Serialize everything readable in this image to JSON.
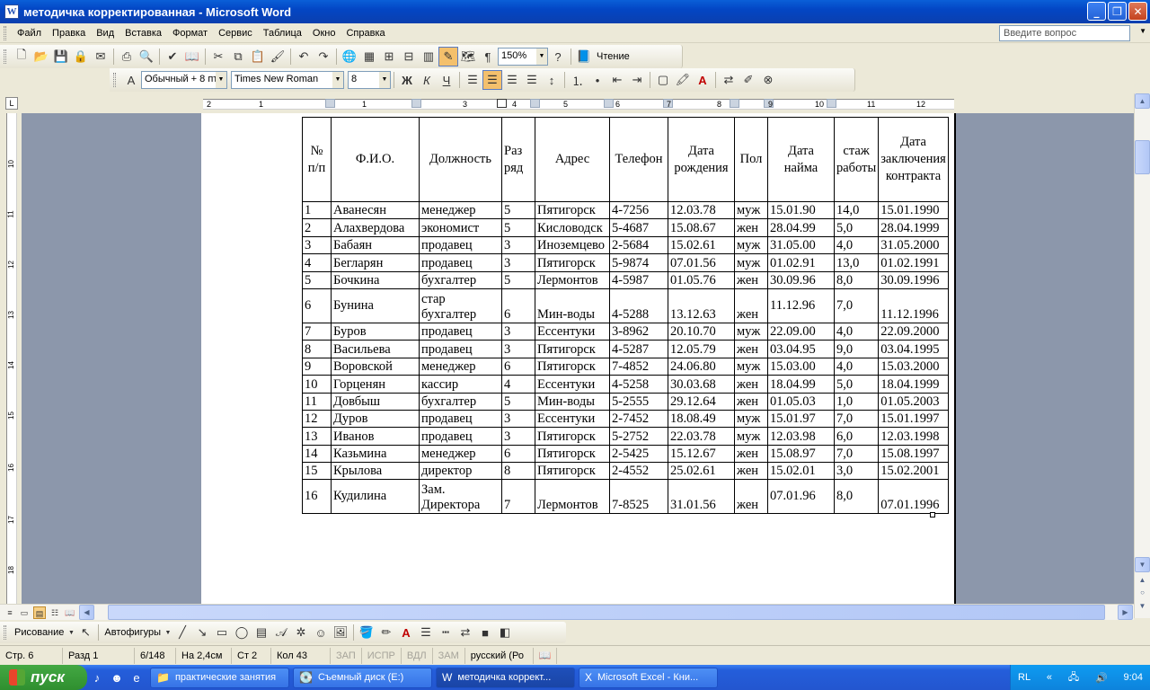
{
  "window": {
    "title": "методичка корректированная - Microsoft Word"
  },
  "menu": {
    "items": [
      "Файл",
      "Правка",
      "Вид",
      "Вставка",
      "Формат",
      "Сервис",
      "Таблица",
      "Окно",
      "Справка"
    ],
    "ask_placeholder": "Введите вопрос"
  },
  "toolbar": {
    "zoom": "150%",
    "reading_label": "Чтение",
    "style": "Обычный + 8 пт",
    "font": "Times New Roman",
    "size": "8"
  },
  "ruler": {
    "numbers": [
      "2",
      "1",
      "1",
      "2",
      "3",
      "4",
      "5",
      "6",
      "7",
      "8",
      "9",
      "10",
      "11",
      "12"
    ],
    "vnumbers": [
      "10",
      "11",
      "12",
      "13",
      "14",
      "15",
      "16",
      "17",
      "18"
    ]
  },
  "table": {
    "headers": [
      "№ п/п",
      "Ф.И.О.",
      "Должность",
      "Раз ряд",
      "Адрес",
      "Телефон",
      "Дата рождения",
      "Пол",
      "Дата найма",
      "стаж работы",
      "Дата заключения контракта"
    ],
    "rows": [
      [
        "1",
        "Аванесян",
        "менеджер",
        "5",
        "Пятигорск",
        "4-7256",
        "12.03.78",
        "муж",
        "15.01.90",
        "14,0",
        "15.01.1990"
      ],
      [
        "2",
        "Алахвердова",
        "экономист",
        "5",
        "Кисловодск",
        "5-4687",
        "15.08.67",
        "жен",
        "28.04.99",
        "5,0",
        "28.04.1999"
      ],
      [
        "3",
        "Бабаян",
        "продавец",
        "3",
        "Иноземцево",
        "2-5684",
        "15.02.61",
        "муж",
        "31.05.00",
        "4,0",
        "31.05.2000"
      ],
      [
        "4",
        "Бегларян",
        "продавец",
        "3",
        "Пятигорск",
        "5-9874",
        "07.01.56",
        "муж",
        "01.02.91",
        "13,0",
        "01.02.1991"
      ],
      [
        "5",
        "Бочкина",
        "бухгалтер",
        "5",
        "Лермонтов",
        "4-5987",
        "01.05.76",
        "жен",
        "30.09.96",
        "8,0",
        "30.09.1996"
      ],
      [
        "6",
        "Бунина",
        "стар бухгалтер",
        "6",
        "Мин-воды",
        "4-5288",
        "13.12.63",
        "жен",
        "11.12.96",
        "7,0",
        "11.12.1996"
      ],
      [
        "7",
        "Буров",
        "продавец",
        "3",
        "Ессентуки",
        "3-8962",
        "20.10.70",
        "муж",
        "22.09.00",
        "4,0",
        "22.09.2000"
      ],
      [
        "8",
        "Васильева",
        "продавец",
        "3",
        "Пятигорск",
        "4-5287",
        "12.05.79",
        "жен",
        "03.04.95",
        "9,0",
        "03.04.1995"
      ],
      [
        "9",
        "Воровской",
        "менеджер",
        "6",
        "Пятигорск",
        "7-4852",
        "24.06.80",
        "муж",
        "15.03.00",
        "4,0",
        "15.03.2000"
      ],
      [
        "10",
        "Горценян",
        "кассир",
        "4",
        "Ессентуки",
        "4-5258",
        "30.03.68",
        "жен",
        "18.04.99",
        "5,0",
        "18.04.1999"
      ],
      [
        "11",
        "Довбыш",
        "бухгалтер",
        "5",
        "Мин-воды",
        "5-2555",
        "29.12.64",
        "жен",
        "01.05.03",
        "1,0",
        "01.05.2003"
      ],
      [
        "12",
        "Дуров",
        "продавец",
        "3",
        "Ессентуки",
        "2-7452",
        "18.08.49",
        "муж",
        "15.01.97",
        "7,0",
        "15.01.1997"
      ],
      [
        "13",
        "Иванов",
        "продавец",
        "3",
        "Пятигорск",
        "5-2752",
        "22.03.78",
        "муж",
        "12.03.98",
        "6,0",
        "12.03.1998"
      ],
      [
        "14",
        "Казьмина",
        "менеджер",
        "6",
        "Пятигорск",
        "2-5425",
        "15.12.67",
        "жен",
        "15.08.97",
        "7,0",
        "15.08.1997"
      ],
      [
        "15",
        "Крылова",
        "директор",
        "8",
        "Пятигорск",
        "2-4552",
        "25.02.61",
        "жен",
        "15.02.01",
        "3,0",
        "15.02.2001"
      ],
      [
        "16",
        "Кудилина",
        "Зам. Директора",
        "7",
        "Лермонтов",
        "7-8525",
        "31.01.56",
        "жен",
        "07.01.96",
        "8,0",
        "07.01.1996"
      ]
    ]
  },
  "drawbar": {
    "draw_label": "Рисование",
    "autoshapes_label": "Автофигуры"
  },
  "status": {
    "page": "Стр. 6",
    "section": "Разд 1",
    "pages": "6/148",
    "at": "На 2,4см",
    "line": "Ст 2",
    "col": "Кол 43",
    "rec": "ЗАП",
    "trk": "ИСПР",
    "ext": "ВДЛ",
    "ovr": "ЗАМ",
    "lang": "русский (Ро"
  },
  "taskbar": {
    "start": "пуск",
    "tasks": [
      "практические занятия",
      "Съемный диск (E:)",
      "методичка коррект...",
      "Microsoft Excel - Кни..."
    ],
    "lang": "RL",
    "clock": "9:04"
  }
}
